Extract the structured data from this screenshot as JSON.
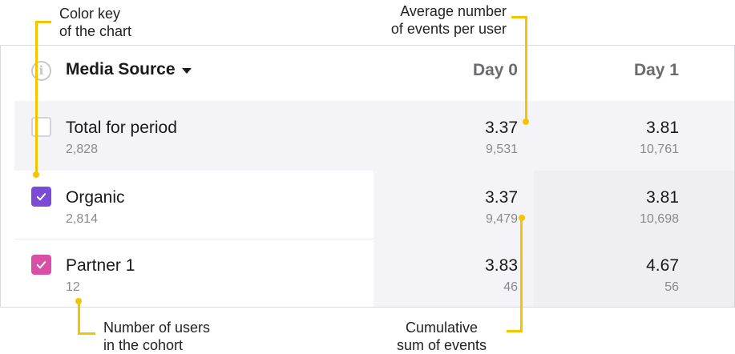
{
  "annotations": {
    "color_key": [
      "Color key",
      "of the chart"
    ],
    "avg_events": [
      "Average number",
      "of events per user"
    ],
    "num_users": [
      "Number of users",
      "in the cohort"
    ],
    "cumulative": [
      "Cumulative",
      "sum of events"
    ]
  },
  "header": {
    "info_icon": "i",
    "title": "Media Source",
    "columns": [
      "Day 0",
      "Day 1"
    ]
  },
  "rows": [
    {
      "name": "Total for period",
      "users": "2,828",
      "checkbox": "unchecked",
      "cells": [
        {
          "avg": "3.37",
          "sum": "9,531"
        },
        {
          "avg": "3.81",
          "sum": "10,761"
        }
      ]
    },
    {
      "name": "Organic",
      "users": "2,814",
      "checkbox": "checked",
      "cells": [
        {
          "avg": "3.37",
          "sum": "9,479"
        },
        {
          "avg": "3.81",
          "sum": "10,698"
        }
      ]
    },
    {
      "name": "Partner 1",
      "users": "12",
      "checkbox": "checked",
      "cells": [
        {
          "avg": "3.83",
          "sum": "46"
        },
        {
          "avg": "4.67",
          "sum": "56"
        }
      ]
    }
  ],
  "colors": {
    "annotation_guide": "#f5c400",
    "organic": "#7b4bd8",
    "partner_1": "#d94fa6",
    "total_row_bg": "#f4f4f8",
    "day0_bg": "#f4f4f8",
    "day1_bg": "#eeeef3"
  }
}
